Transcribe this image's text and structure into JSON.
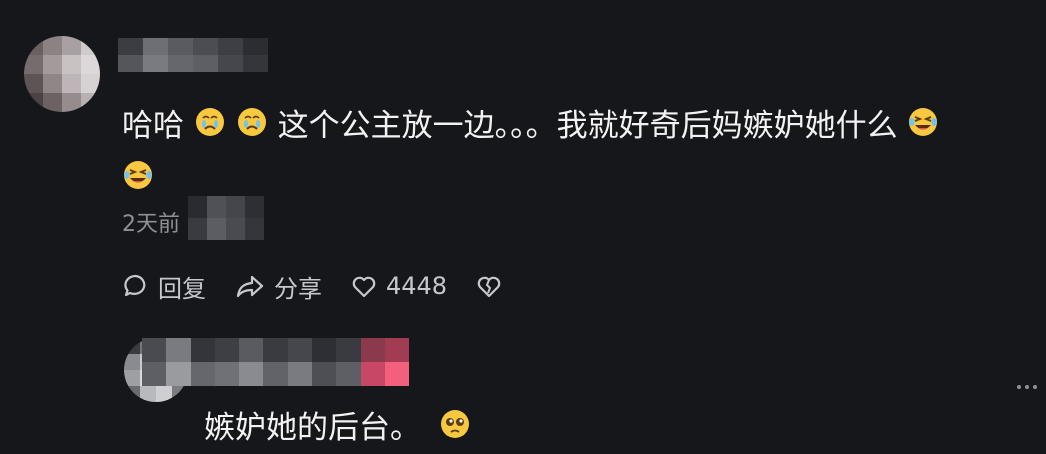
{
  "comment": {
    "text_part1": "哈哈",
    "text_part2": "这个公主放一边。。。我就好奇后妈嫉妒她什么",
    "emoji_1": "crying-sad-emoji",
    "emoji_2": "crying-sad-emoji",
    "emoji_3": "laughing-tears-emoji",
    "emoji_4": "laughing-tears-emoji",
    "timestamp": "2天前"
  },
  "actions": {
    "reply_label": "回复",
    "share_label": "分享",
    "like_count": "4448",
    "reply_icon": "comment-bubble-icon",
    "share_icon": "share-arrow-icon",
    "like_icon": "heart-icon",
    "dislike_icon": "broken-heart-icon"
  },
  "reply": {
    "text": "嫉妒她的后台。",
    "emoji": "pleading-emoji"
  },
  "colors": {
    "background": "#16171b",
    "text": "#f2f2f2",
    "muted": "#8f9096",
    "emoji_yellow": "#f7c840"
  }
}
